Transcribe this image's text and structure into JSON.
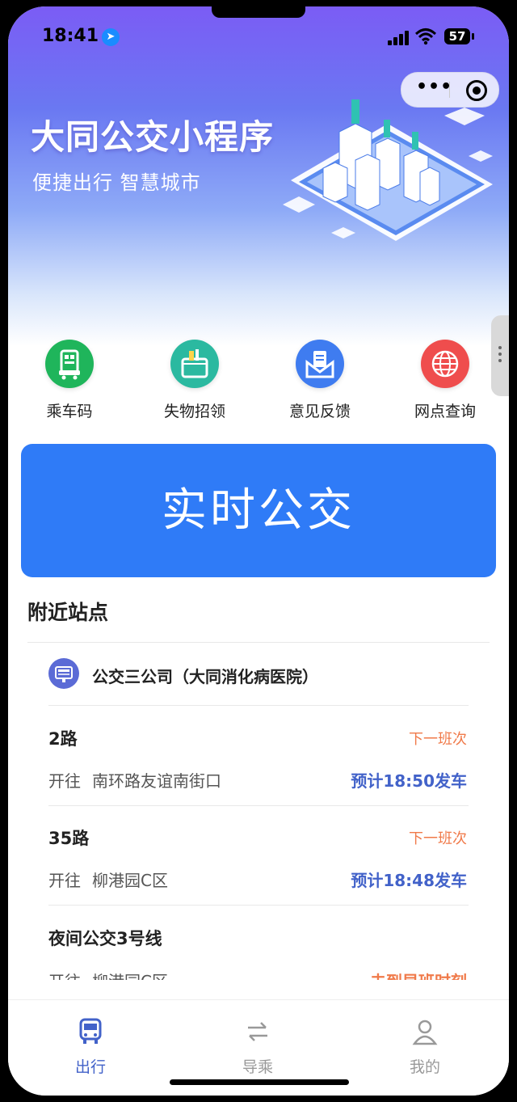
{
  "status_bar": {
    "time": "18:41",
    "battery": "57"
  },
  "hero": {
    "title": "大同公交小程序",
    "subtitle": "便捷出行 智慧城市"
  },
  "shortcuts": [
    {
      "label": "乘车码",
      "icon": "qr-bus-icon",
      "color": "#1fb55b"
    },
    {
      "label": "失物招领",
      "icon": "lost-found-icon",
      "color": "#2bb9a0"
    },
    {
      "label": "意见反馈",
      "icon": "feedback-mail-icon",
      "color": "#3f7cf0"
    },
    {
      "label": "网点查询",
      "icon": "globe-icon",
      "color": "#ef4d4d"
    }
  ],
  "realtime_button": {
    "label": "实时公交",
    "color": "#2f7bf7"
  },
  "nearby": {
    "title": "附近站点",
    "station": "公交三公司（大同消化病医院）",
    "routes": [
      {
        "name": "2路",
        "next_label": "下一班次",
        "toward_label": "开往",
        "destination": "南环路友谊南街口",
        "eta": "预计18:50发车"
      },
      {
        "name": "35路",
        "next_label": "下一班次",
        "toward_label": "开往",
        "destination": "柳港园C区",
        "eta": "预计18:48发车"
      },
      {
        "name": "夜间公交3号线",
        "toward_label": "开往",
        "destination": "柳港园C区",
        "eta": "未到早班时刻"
      }
    ]
  },
  "tabbar": [
    {
      "label": "出行",
      "icon": "bus-icon",
      "active": true
    },
    {
      "label": "导乘",
      "icon": "transfer-arrows-icon",
      "active": false
    },
    {
      "label": "我的",
      "icon": "user-icon",
      "active": false
    }
  ]
}
